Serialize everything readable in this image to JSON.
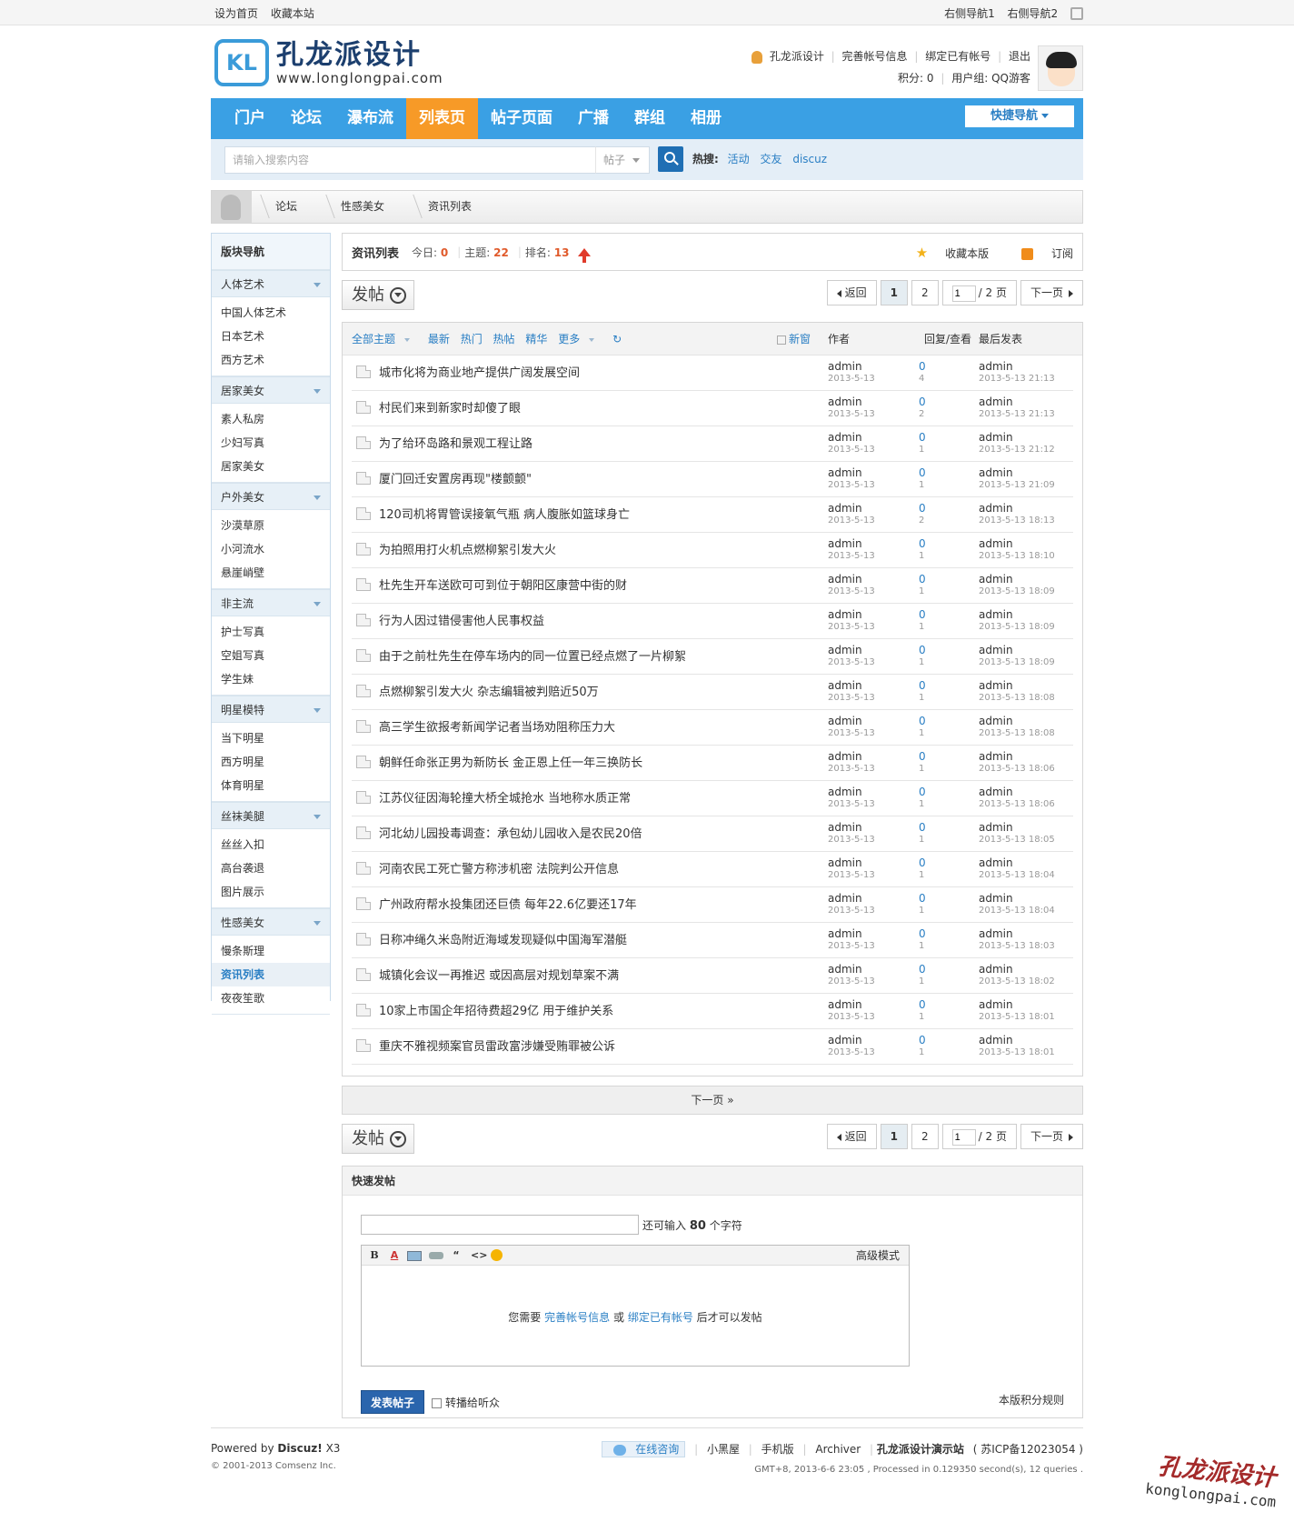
{
  "topbar": {
    "left": [
      "设为首页",
      "收藏本站"
    ],
    "right": [
      "右侧导航1",
      "右侧导航2"
    ]
  },
  "logo": {
    "title": "孔龙派设计",
    "url": "www.longlongpai.com",
    "mark": "KL"
  },
  "user": {
    "name": "孔龙派设计",
    "links": [
      "完善帐号信息",
      "绑定已有帐号",
      "退出"
    ],
    "points": "积分: 0",
    "group": "用户组: QQ游客"
  },
  "nav": {
    "items": [
      "门户",
      "论坛",
      "瀑布流",
      "列表页",
      "帖子页面",
      "广播",
      "群组",
      "相册"
    ],
    "active_index": 3,
    "quick": "快捷导航"
  },
  "search": {
    "placeholder": "请输入搜索内容",
    "type": "帖子",
    "hot_label": "热搜:",
    "hot": [
      "活动",
      "交友",
      "discuz"
    ]
  },
  "breadcrumb": [
    "论坛",
    "性感美女",
    "资讯列表"
  ],
  "sidebar": {
    "title": "版块导航",
    "groups": [
      {
        "title": "人体艺术",
        "items": [
          "中国人体艺术",
          "日本艺术",
          "西方艺术"
        ]
      },
      {
        "title": "居家美女",
        "items": [
          "素人私房",
          "少妇写真",
          "居家美女"
        ]
      },
      {
        "title": "户外美女",
        "items": [
          "沙漠草原",
          "小河流水",
          "悬崖峭壁"
        ]
      },
      {
        "title": "非主流",
        "items": [
          "护士写真",
          "空姐写真",
          "学生妹"
        ]
      },
      {
        "title": "明星模特",
        "items": [
          "当下明星",
          "西方明星",
          "体育明星"
        ]
      },
      {
        "title": "丝袜美腿",
        "items": [
          "丝丝入扣",
          "高台袭退",
          "图片展示"
        ]
      },
      {
        "title": "性感美女",
        "items": [
          "慢条斯理",
          "资讯列表",
          "夜夜笙歌"
        ]
      }
    ],
    "active": "资讯列表"
  },
  "board": {
    "name": "资讯列表",
    "today_label": "今日:",
    "today": "0",
    "topics_label": "主题:",
    "topics": "22",
    "rank_label": "排名:",
    "rank": "13",
    "favorite": "收藏本版",
    "subscribe": "订阅"
  },
  "pager": {
    "post": "发帖",
    "back": "返回",
    "pages": [
      "1",
      "2"
    ],
    "current": "1",
    "total": "/ 2 页",
    "next": "下一页"
  },
  "thread_head": {
    "filters": [
      "全部主题",
      "最新",
      "热门",
      "热帖",
      "精华",
      "更多",
      "↻"
    ],
    "new_window": "新窗",
    "author": "作者",
    "reply_view": "回复/查看",
    "last_post": "最后发表"
  },
  "threads": [
    {
      "title": "城市化将为商业地产提供广阔发展空间",
      "author": "admin",
      "date": "2013-5-13",
      "replies": "0",
      "views": "4",
      "last_user": "admin",
      "last_time": "2013-5-13 21:13"
    },
    {
      "title": "村民们来到新家时却傻了眼",
      "author": "admin",
      "date": "2013-5-13",
      "replies": "0",
      "views": "2",
      "last_user": "admin",
      "last_time": "2013-5-13 21:13"
    },
    {
      "title": "为了给环岛路和景观工程让路",
      "author": "admin",
      "date": "2013-5-13",
      "replies": "0",
      "views": "1",
      "last_user": "admin",
      "last_time": "2013-5-13 21:12"
    },
    {
      "title": "厦门回迁安置房再现\"楼颤颤\"",
      "author": "admin",
      "date": "2013-5-13",
      "replies": "0",
      "views": "1",
      "last_user": "admin",
      "last_time": "2013-5-13 21:09"
    },
    {
      "title": "120司机将胃管误接氧气瓶 病人腹胀如篮球身亡",
      "author": "admin",
      "date": "2013-5-13",
      "replies": "0",
      "views": "2",
      "last_user": "admin",
      "last_time": "2013-5-13 18:13"
    },
    {
      "title": "为拍照用打火机点燃柳絮引发大火",
      "author": "admin",
      "date": "2013-5-13",
      "replies": "0",
      "views": "1",
      "last_user": "admin",
      "last_time": "2013-5-13 18:10"
    },
    {
      "title": "杜先生开车送欧可可到位于朝阳区康营中街的财",
      "author": "admin",
      "date": "2013-5-13",
      "replies": "0",
      "views": "1",
      "last_user": "admin",
      "last_time": "2013-5-13 18:09"
    },
    {
      "title": "行为人因过错侵害他人民事权益",
      "author": "admin",
      "date": "2013-5-13",
      "replies": "0",
      "views": "1",
      "last_user": "admin",
      "last_time": "2013-5-13 18:09"
    },
    {
      "title": "由于之前杜先生在停车场内的同一位置已经点燃了一片柳絮",
      "author": "admin",
      "date": "2013-5-13",
      "replies": "0",
      "views": "1",
      "last_user": "admin",
      "last_time": "2013-5-13 18:09"
    },
    {
      "title": "点燃柳絮引发大火 杂志编辑被判赔近50万",
      "author": "admin",
      "date": "2013-5-13",
      "replies": "0",
      "views": "1",
      "last_user": "admin",
      "last_time": "2013-5-13 18:08"
    },
    {
      "title": "高三学生欲报考新闻学记者当场劝阻称压力大",
      "author": "admin",
      "date": "2013-5-13",
      "replies": "0",
      "views": "1",
      "last_user": "admin",
      "last_time": "2013-5-13 18:08"
    },
    {
      "title": "朝鲜任命张正男为新防长 金正恩上任一年三换防长",
      "author": "admin",
      "date": "2013-5-13",
      "replies": "0",
      "views": "1",
      "last_user": "admin",
      "last_time": "2013-5-13 18:06"
    },
    {
      "title": "江苏仪征因海轮撞大桥全城抢水 当地称水质正常",
      "author": "admin",
      "date": "2013-5-13",
      "replies": "0",
      "views": "1",
      "last_user": "admin",
      "last_time": "2013-5-13 18:06"
    },
    {
      "title": "河北幼儿园投毒调查：承包幼儿园收入是农民20倍",
      "author": "admin",
      "date": "2013-5-13",
      "replies": "0",
      "views": "1",
      "last_user": "admin",
      "last_time": "2013-5-13 18:05"
    },
    {
      "title": "河南农民工死亡警方称涉机密 法院判公开信息",
      "author": "admin",
      "date": "2013-5-13",
      "replies": "0",
      "views": "1",
      "last_user": "admin",
      "last_time": "2013-5-13 18:04"
    },
    {
      "title": "广州政府帮水投集团还巨债 每年22.6亿要还17年",
      "author": "admin",
      "date": "2013-5-13",
      "replies": "0",
      "views": "1",
      "last_user": "admin",
      "last_time": "2013-5-13 18:04"
    },
    {
      "title": "日称冲绳久米岛附近海域发现疑似中国海军潜艇",
      "author": "admin",
      "date": "2013-5-13",
      "replies": "0",
      "views": "1",
      "last_user": "admin",
      "last_time": "2013-5-13 18:03"
    },
    {
      "title": "城镇化会议一再推迟 或因高层对规划草案不满",
      "author": "admin",
      "date": "2013-5-13",
      "replies": "0",
      "views": "1",
      "last_user": "admin",
      "last_time": "2013-5-13 18:02"
    },
    {
      "title": "10家上市国企年招待费超29亿 用于维护关系",
      "author": "admin",
      "date": "2013-5-13",
      "replies": "0",
      "views": "1",
      "last_user": "admin",
      "last_time": "2013-5-13 18:01"
    },
    {
      "title": "重庆不雅视频案官员雷政富涉嫌受贿罪被公诉",
      "author": "admin",
      "date": "2013-5-13",
      "replies": "0",
      "views": "1",
      "last_user": "admin",
      "last_time": "2013-5-13 18:01"
    }
  ],
  "next_page": "下一页 »",
  "quick_post": {
    "title": "快速发帖",
    "limit_prefix": "还可输入",
    "limit": "80",
    "limit_suffix": "个字符",
    "advanced": "高级模式",
    "msg_prefix": "您需要",
    "link1": "完善帐号信息",
    "msg_mid": "或",
    "link2": "绑定已有帐号",
    "msg_suffix": "后才可以发帖",
    "submit": "发表帖子",
    "share": "转播给听众",
    "rules": "本版积分规则"
  },
  "footer": {
    "powered_prefix": "Powered by",
    "powered": "Discuz!",
    "version": "X3",
    "copyright": "© 2001-2013 Comsenz Inc.",
    "consult": "在线咨询",
    "links": [
      "小黑屋",
      "手机版",
      "Archiver"
    ],
    "site": "孔龙派设计演示站",
    "icp": "( 苏ICP备12023054 )",
    "info": "GMT+8, 2013-6-6 23:05 , Processed in 0.129350 second(s), 12 queries ."
  },
  "watermark": {
    "title": "孔龙派设计",
    "url": "konglongpai.com"
  }
}
